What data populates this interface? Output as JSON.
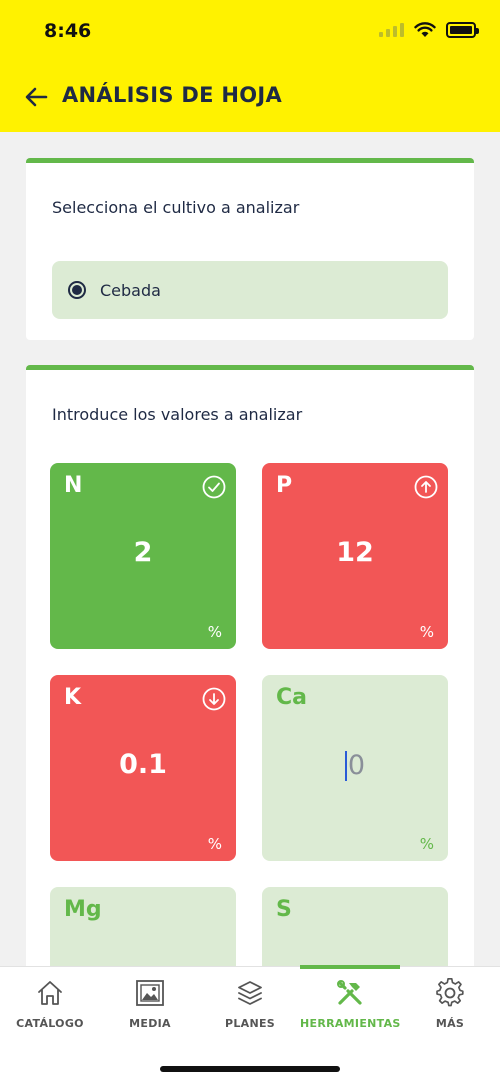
{
  "status_bar": {
    "time": "8:46",
    "wifi_icon": "wifi-icon",
    "battery_icon": "battery-icon",
    "signal_icon": "cellular-signal-icon"
  },
  "header": {
    "title": "ANÁLISIS DE HOJA",
    "back_icon": "arrow-left-icon",
    "background_color": "#fff200"
  },
  "crop_section": {
    "title": "Selecciona el cultivo a analizar",
    "options": [
      {
        "label": "Cebada",
        "selected": true
      }
    ]
  },
  "values_section": {
    "title": "Introduce los valores a analizar",
    "nutrients": [
      {
        "symbol": "N",
        "value": "2",
        "unit": "%",
        "status": "ok",
        "status_icon": "check-circle-icon",
        "color": "#63b84a"
      },
      {
        "symbol": "P",
        "value": "12",
        "unit": "%",
        "status": "high",
        "status_icon": "arrow-up-circle-icon",
        "color": "#f25656"
      },
      {
        "symbol": "K",
        "value": "0.1",
        "unit": "%",
        "status": "low",
        "status_icon": "arrow-down-circle-icon",
        "color": "#f25656"
      },
      {
        "symbol": "Ca",
        "value": "0",
        "unit": "%",
        "status": "editing"
      },
      {
        "symbol": "Mg",
        "value": "",
        "unit": ""
      },
      {
        "symbol": "S",
        "value": "",
        "unit": ""
      }
    ]
  },
  "bottom_nav": {
    "items": [
      {
        "label": "CATÁLOGO",
        "icon": "home-icon",
        "active": false
      },
      {
        "label": "MEDIA",
        "icon": "image-gallery-icon",
        "active": false
      },
      {
        "label": "PLANES",
        "icon": "layers-icon",
        "active": false
      },
      {
        "label": "HERRAMIENTAS",
        "icon": "tools-icon",
        "active": true
      },
      {
        "label": "MÁS",
        "icon": "gear-icon",
        "active": false
      }
    ]
  },
  "colors": {
    "accent_green": "#63b84a",
    "alert_red": "#f25656",
    "light_green": "#dcebd4",
    "text_dark": "#1f2a44"
  }
}
